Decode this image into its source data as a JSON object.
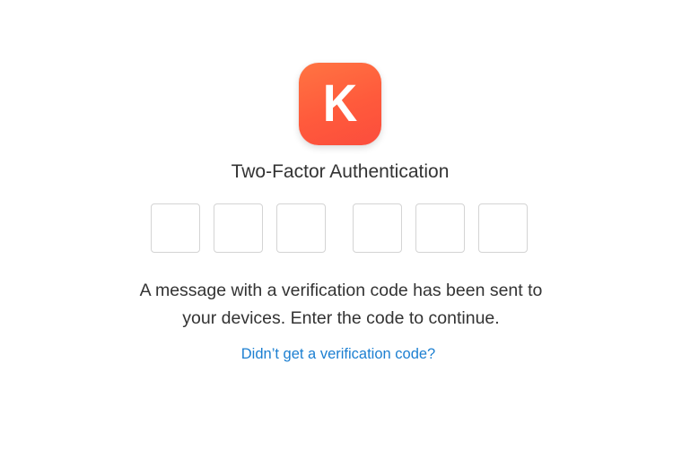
{
  "app_icon": {
    "letter": "K",
    "icon_name": "app-logo-icon",
    "gradient_colors": [
      "#ff7442",
      "#fb4d3d"
    ]
  },
  "title": "Two-Factor Authentication",
  "code_boxes": [
    {
      "value": ""
    },
    {
      "value": ""
    },
    {
      "value": ""
    },
    {
      "value": ""
    },
    {
      "value": ""
    },
    {
      "value": ""
    }
  ],
  "message": {
    "line1": "A message with a verification code has been sent to",
    "line2": "your devices. Enter the code to continue."
  },
  "help_link": {
    "label": "Didn’t get a verification code?",
    "color": "#1c7fd1"
  }
}
